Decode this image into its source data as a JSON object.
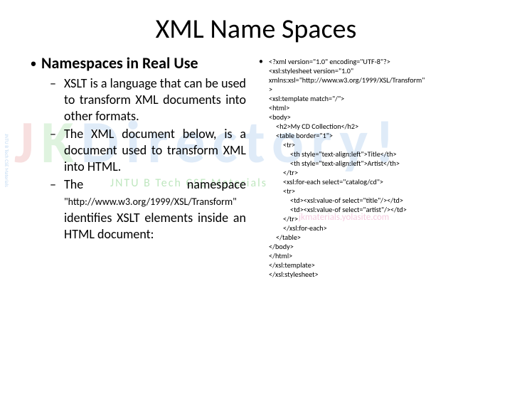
{
  "title": "XML Name Spaces",
  "left": {
    "heading": "Namespaces in Real Use",
    "s1a": "XSLT is a language that can be used to transform XML documents into other formats.",
    "s2a": "The XML document below, is a document used to transform XML into HTML.",
    "s3a": "The namespace ",
    "s3b": "\"http://www.w3.org/1999/XSL/Transform\"",
    "s3c": " identifies XSLT elements inside an HTML document:"
  },
  "code": {
    "l01": "<?xml version=\"1.0\" encoding=\"UTF-8\"?>",
    "l02": "<xsl:stylesheet version=\"1.0\"",
    "l03": "xmlns:xsl=\"http://www.w3.org/1999/XSL/Transform\"",
    "l04": ">",
    "l05": "<xsl:template match=\"/\">",
    "l06": "<html>",
    "l07": "<body>",
    "l08": "<h2>My CD Collection</h2>",
    "l09": "<table border=\"1\">",
    "l10": "<tr>",
    "l11": "<th style=\"text-align:left\">Title</th>",
    "l12": "<th style=\"text-align:left\">Artist</th>",
    "l13": "</tr>",
    "l14": "<xsl:for-each select=\"catalog/cd\">",
    "l15": "<tr>",
    "l16": "<td><xsl:value-of select=\"title\"/></td>",
    "l17": "<td><xsl:value-of select=\"artist\"/></td>",
    "l18": "</tr>",
    "l19": "</xsl:for-each>",
    "l20": "</table>",
    "l21": "</body>",
    "l22": "</html>",
    "l23": "</xsl:template>",
    "l24": "</xsl:stylesheet>"
  },
  "wm": {
    "j": "J",
    "k": "K",
    "d": "Directory!",
    "sub": "JNTU B Tech CSE Materials",
    "url": "jkmaterials.yolasite.com",
    "side": "JNTU B Tech CSE Materials"
  }
}
